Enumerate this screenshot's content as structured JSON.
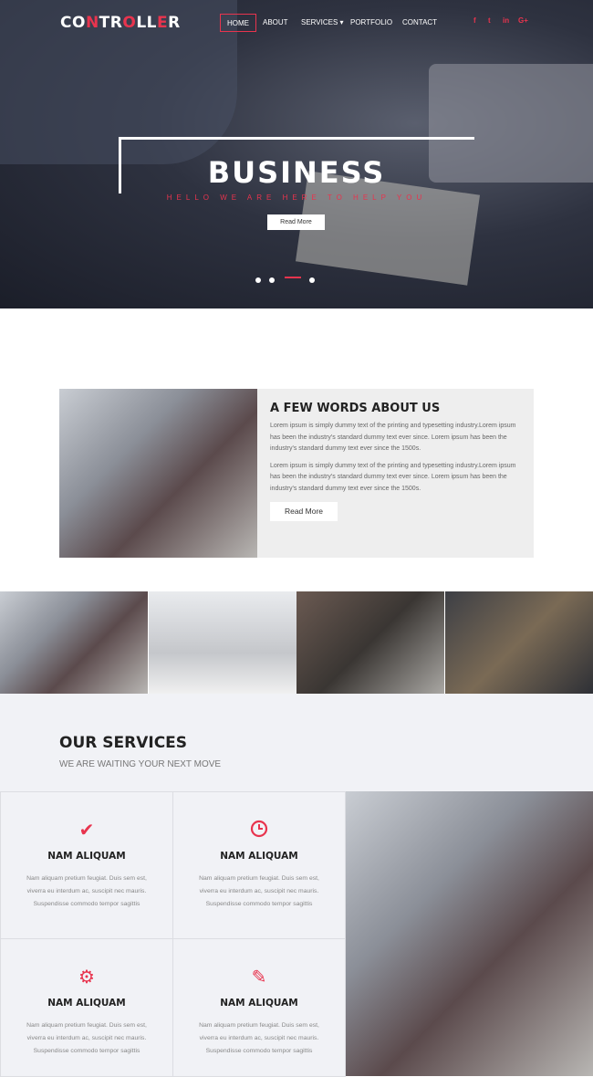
{
  "header": {
    "logo": {
      "p1": "CO",
      "p2": "N",
      "p3": "TR",
      "p4": "O",
      "p5": "LL",
      "p6": "E",
      "p7": "R"
    },
    "nav": [
      "HOME",
      "ABOUT",
      "SERVICES ▾",
      "PORTFOLIO",
      "CONTACT"
    ],
    "social": [
      "f",
      "t",
      "in",
      "G+"
    ]
  },
  "hero": {
    "title": "BUSINESS",
    "subtitle": "HELLO WE ARE HERE TO HELP YOU",
    "button": "Read More",
    "active_slide": 3,
    "slides": 4
  },
  "about": {
    "title": "A FEW WORDS ABOUT US",
    "paragraphs": [
      "Lorem ipsum is simply dummy text of the printing and typesetting industry.Lorem ipsum has been the industry's standard dummy text ever since. Lorem ipsum has been the industry's standard dummy text ever since the 1500s.",
      "Lorem ipsum is simply dummy text of the printing and typesetting industry.Lorem ipsum has been the industry's standard dummy text ever since. Lorem ipsum has been the industry's standard dummy text ever since the 1500s."
    ],
    "button": "Read More"
  },
  "services": {
    "title": "OUR SERVICES",
    "subtitle": "WE ARE WAITING YOUR NEXT MOVE",
    "items": [
      {
        "icon": "check-icon",
        "title": "NAM ALIQUAM",
        "text": "Nam aliquam pretium feugiat. Duis sem est, viverra eu interdum ac, suscipit nec mauris. Suspendisse commodo tempor sagittis"
      },
      {
        "icon": "clock-icon",
        "title": "NAM ALIQUAM",
        "text": "Nam aliquam pretium feugiat. Duis sem est, viverra eu interdum ac, suscipit nec mauris. Suspendisse commodo tempor sagittis"
      },
      {
        "icon": "gear-icon",
        "title": "NAM ALIQUAM",
        "text": "Nam aliquam pretium feugiat. Duis sem est, viverra eu interdum ac, suscipit nec mauris. Suspendisse commodo tempor sagittis"
      },
      {
        "icon": "pencil-icon",
        "title": "NAM ALIQUAM",
        "text": "Nam aliquam pretium feugiat. Duis sem est, viverra eu interdum ac, suscipit nec mauris. Suspendisse commodo tempor sagittis"
      }
    ]
  },
  "colors": {
    "accent": "#e8344e",
    "panel": "#eeeeee",
    "services_bg": "#f1f2f6"
  }
}
